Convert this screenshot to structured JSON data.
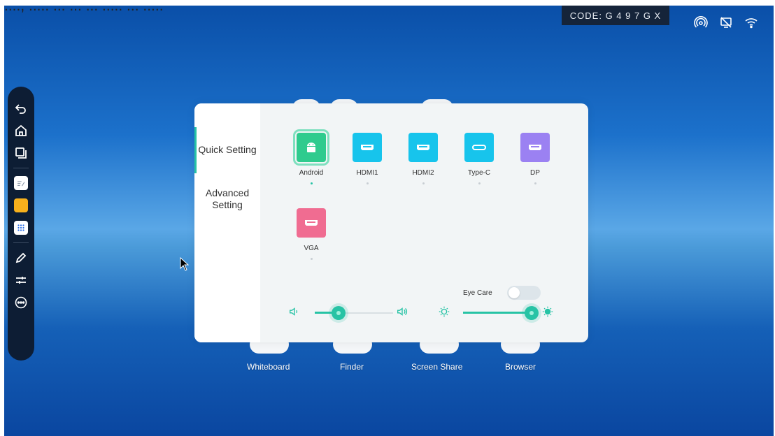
{
  "top_text": "...., ..... ... ... ... ..... ... .....",
  "code_badge": "CODE: G 4 9 7 G X",
  "status_icons": [
    "hotspot-icon",
    "screen-share-off-icon",
    "wifi-icon"
  ],
  "toolbar_icons": [
    "back-icon",
    "home-icon",
    "multitask-icon",
    "note-icon",
    "sticky-note-icon",
    "apps-grid-icon",
    "pen-icon",
    "sliders-icon",
    "more-icon"
  ],
  "dialog": {
    "nav": {
      "quick_setting": "Quick Setting",
      "advanced_setting": "Advanced\nSetting",
      "active": "quick_setting"
    },
    "sources": [
      {
        "label": "Android",
        "color": "#2fcb8e",
        "selected": true
      },
      {
        "label": "HDMI1",
        "color": "#17c4ec",
        "selected": false
      },
      {
        "label": "HDMI2",
        "color": "#17c4ec",
        "selected": false
      },
      {
        "label": "Type-C",
        "color": "#17c4ec",
        "selected": false
      },
      {
        "label": "DP",
        "color": "#9b81f2",
        "selected": false
      },
      {
        "label": "VGA",
        "color": "#f06c91",
        "selected": false
      }
    ],
    "eye_care": {
      "label": "Eye Care",
      "enabled": false
    },
    "volume": {
      "value": 0.3
    },
    "brightness": {
      "value": 1.0
    }
  },
  "dock": [
    "Whiteboard",
    "Finder",
    "Screen Share",
    "Browser"
  ],
  "colors": {
    "accent": "#27c3a5",
    "toolbar": "#0d1d34",
    "badge": "#15243a"
  }
}
